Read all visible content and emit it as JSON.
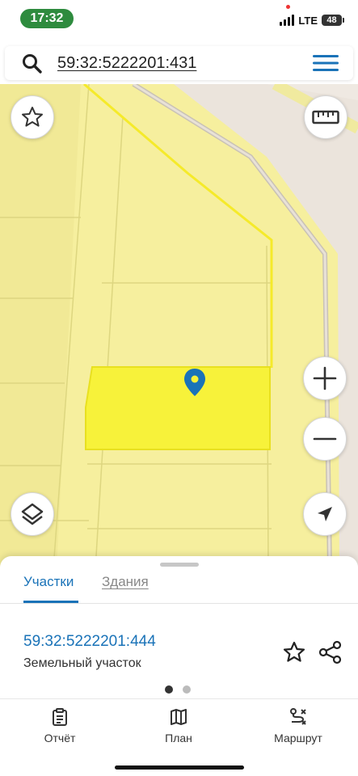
{
  "status_bar": {
    "time": "17:32",
    "network": "LTE",
    "battery": "48"
  },
  "search": {
    "query": "59:32:5222201:431",
    "icon": "search-icon",
    "menu_icon": "hamburger-menu-icon"
  },
  "map": {
    "buttons": [
      "favorite-star-icon",
      "ruler-icon",
      "zoom-in-icon",
      "zoom-out-icon",
      "layers-icon",
      "locate-arrow-icon"
    ],
    "colors": {
      "parcel_fill": "#f6ef9e",
      "parcel_border": "#ddd680",
      "selected_parcel": "#f7f23a",
      "road": "#ebe4dc",
      "road_edge": "#c9c2b6",
      "outline_highlight": "#f5ea2a",
      "marker": "#1a73b8"
    }
  },
  "sheet": {
    "tabs": [
      {
        "label": "Участки",
        "active": true
      },
      {
        "label": "Здания",
        "active": false
      }
    ],
    "parcel_id": "59:32:5222201:444",
    "parcel_type": "Земельный участок",
    "pager": {
      "current": 1,
      "total": 2
    }
  },
  "bottom_nav": [
    {
      "label": "Отчёт",
      "icon": "report-icon"
    },
    {
      "label": "План",
      "icon": "map-plan-icon"
    },
    {
      "label": "Маршрут",
      "icon": "route-icon"
    }
  ],
  "accent_color": "#1a73b8"
}
